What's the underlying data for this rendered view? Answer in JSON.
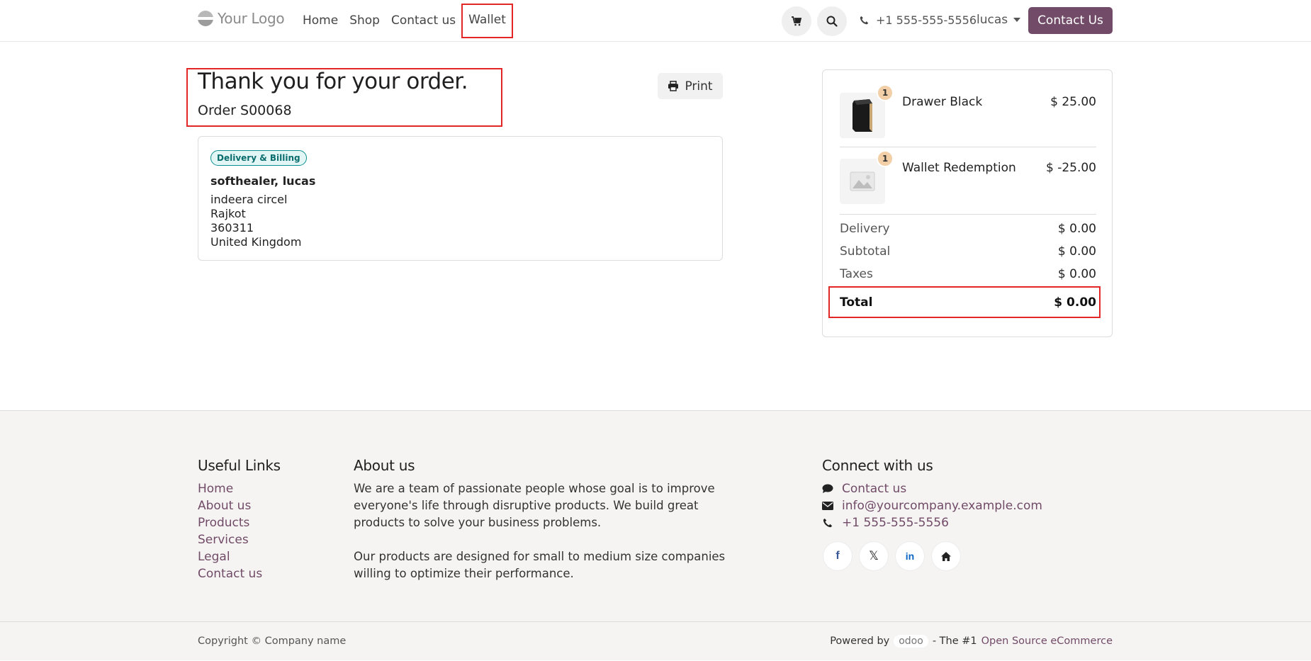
{
  "header": {
    "logo_text": "Your Logo",
    "nav": [
      "Home",
      "Shop",
      "Contact us",
      "Wallet"
    ],
    "phone": "+1 555-555-5556",
    "user": "lucas",
    "contact_button": "Contact Us"
  },
  "confirmation": {
    "title": "Thank you for your order.",
    "order": "Order S00068",
    "print_label": "Print"
  },
  "address": {
    "badge": "Delivery & Billing",
    "name": "softhealer, lucas",
    "street": "indeera circel",
    "city": "Rajkot",
    "zip": "360311",
    "country": "United Kingdom"
  },
  "summary": {
    "items": [
      {
        "name": "Drawer Black",
        "price": "$ 25.00",
        "qty": "1"
      },
      {
        "name": "Wallet Redemption",
        "price": "$ -25.00",
        "qty": "1"
      }
    ],
    "delivery_label": "Delivery",
    "delivery": "$ 0.00",
    "subtotal_label": "Subtotal",
    "subtotal": "$ 0.00",
    "taxes_label": "Taxes",
    "taxes": "$ 0.00",
    "total_label": "Total",
    "total": "$ 0.00"
  },
  "footer": {
    "links_title": "Useful Links",
    "links": [
      "Home",
      "About us",
      "Products",
      "Services",
      "Legal",
      "Contact us"
    ],
    "about_title": "About us",
    "about_p1": "We are a team of passionate people whose goal is to improve everyone's life through disruptive products. We build great products to solve your business problems.",
    "about_p2": "Our products are designed for small to medium size companies willing to optimize their performance.",
    "connect_title": "Connect with us",
    "connect_contact": "Contact us",
    "connect_email": "info@yourcompany.example.com",
    "connect_phone": "+1 555-555-5556",
    "copyright": "Copyright © Company name",
    "powered_by": "Powered by",
    "odoo": "odoo",
    "tagline": "- The #1",
    "tagline_link": "Open Source eCommerce"
  }
}
